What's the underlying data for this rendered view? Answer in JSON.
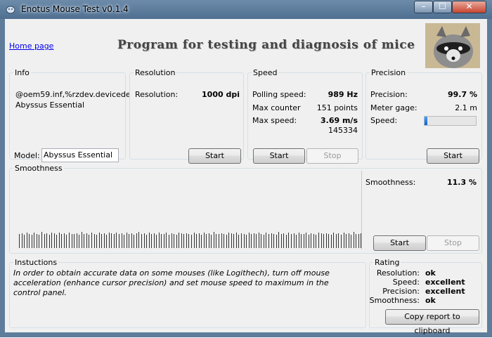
{
  "window": {
    "title": "Enotus Mouse Test v0.1.4",
    "min_glyph": "–",
    "max_glyph": "☐",
    "close_glyph": "✕"
  },
  "header": {
    "home_link": "Home page",
    "banner": "Program for testing and diagnosis of mice"
  },
  "info": {
    "legend": "Info",
    "device_id": "@oem59.inf,%rzdev.devicede",
    "device_name": "Abyssus Essential",
    "model_label": "Model:",
    "model_value": "Abyssus Essential"
  },
  "resolution": {
    "legend": "Resolution",
    "label": "Resolution:",
    "value": "1000 dpi",
    "start": "Start"
  },
  "speed": {
    "legend": "Speed",
    "polling_label": "Polling speed:",
    "polling_value": "989 Hz",
    "counter_label": "Max counter",
    "counter_value": "151 points",
    "max_label": "Max  speed:",
    "max_value": "3.69 m/s",
    "extra_value": "145334",
    "start": "Start",
    "stop": "Stop"
  },
  "precision": {
    "legend": "Precision",
    "precision_label": "Precision:",
    "precision_value": "99.7 %",
    "meter_label": "Meter gage:",
    "meter_value": "2.1 m",
    "speed_label": "Speed:",
    "speed_level": 0.05,
    "start": "Start"
  },
  "smoothness": {
    "legend": "Smoothness",
    "label": "Smoothness:",
    "value": "11.3 %",
    "start": "Start",
    "stop": "Stop",
    "samples": [
      0.82,
      0.88,
      0.8,
      0.92,
      0.85,
      0.78,
      0.9,
      0.84,
      0.8,
      0.95,
      0.83,
      0.88,
      0.79,
      0.9,
      0.86,
      0.81,
      0.93,
      0.84,
      0.87,
      0.8,
      0.91,
      0.85,
      0.82,
      0.89,
      0.8,
      0.94,
      0.83,
      0.86,
      0.81,
      0.9,
      0.85,
      0.79,
      0.92,
      0.84,
      0.88,
      0.8,
      0.9,
      0.86,
      0.82,
      0.93,
      0.84,
      0.87,
      0.8,
      0.91,
      0.83,
      0.89,
      0.81,
      0.86,
      0.95,
      0.82,
      0.88,
      0.8,
      0.9,
      0.84,
      0.86,
      0.79,
      0.92,
      0.85,
      0.83,
      0.9,
      0.81,
      0.88,
      0.84,
      0.8,
      0.93,
      0.86,
      0.82,
      0.89,
      0.85,
      0.8,
      0.91,
      0.84,
      0.87,
      0.81,
      0.9,
      0.83,
      0.88,
      0.8,
      0.94,
      0.85,
      0.82,
      0.89,
      0.84,
      0.8,
      0.92,
      0.86,
      0.83,
      0.9,
      0.81,
      0.88,
      0.85,
      0.8,
      0.93,
      0.84,
      0.87,
      0.82,
      0.9,
      0.85,
      0.8,
      0.91,
      0.83,
      0.88,
      0.84,
      0.8,
      0.95,
      0.82,
      0.86,
      0.81,
      0.9,
      0.84,
      0.88,
      0.8,
      0.92,
      0.85,
      0.83,
      0.9,
      0.81,
      0.87,
      0.84,
      0.8,
      0.93,
      0.86,
      0.82,
      0.89,
      0.85,
      0.8,
      0.91,
      0.84,
      0.88,
      0.81,
      0.9,
      0.83,
      0.86,
      0.8,
      0.94,
      0.85,
      0.82,
      0.88
    ]
  },
  "instructions": {
    "legend": "Instuctions",
    "text": "In order to obtain accurate data on some mouses (like Logithech), turn off mouse acceleration (enhance cursor precision) and set mouse speed to maximum in the control panel."
  },
  "rating": {
    "legend": "Rating",
    "rows": [
      {
        "label": "Resolution:",
        "value": "ok"
      },
      {
        "label": "Speed:",
        "value": "excellent"
      },
      {
        "label": "Precision:",
        "value": "excellent"
      },
      {
        "label": "Smoothness:",
        "value": "ok"
      }
    ],
    "copy_button": "Copy report to clipboard"
  }
}
